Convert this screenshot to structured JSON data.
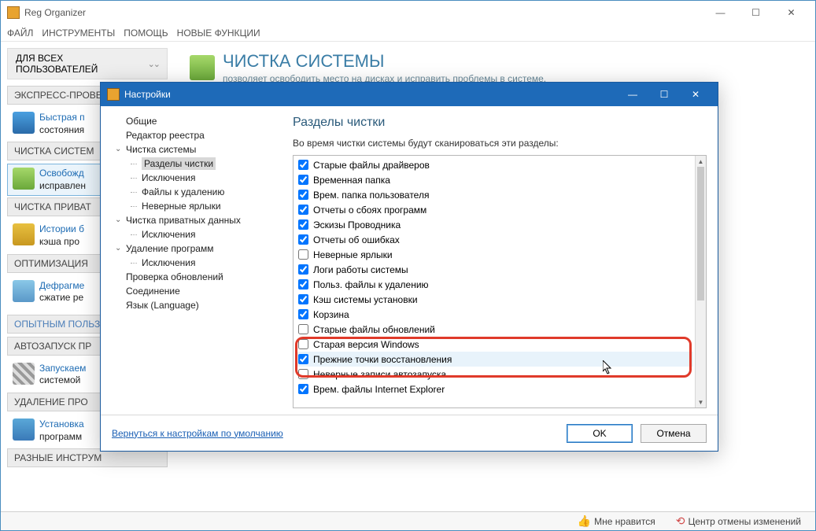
{
  "app": {
    "title": "Reg Organizer"
  },
  "menu": [
    "ФАЙЛ",
    "ИНСТРУМЕНТЫ",
    "ПОМОЩЬ",
    "НОВЫЕ ФУНКЦИИ"
  ],
  "userSwitch": "ДЛЯ ВСЕХ ПОЛЬЗОВАТЕЛЕЙ",
  "sidebar": {
    "groups": [
      {
        "header": "ЭКСПРЕСС-ПРОВЕРКА",
        "items": [
          {
            "l1": "Быстрая п",
            "l2": "состояния"
          }
        ]
      },
      {
        "header": "ЧИСТКА СИСТЕМ",
        "selected": true,
        "items": [
          {
            "l1": "Освобожд",
            "l2": "исправлен",
            "sel": true
          }
        ]
      },
      {
        "header": "ЧИСТКА ПРИВАТ",
        "items": [
          {
            "l1": "Истории б",
            "l2": "кэша про"
          }
        ]
      },
      {
        "header": "ОПТИМИЗАЦИЯ",
        "items": [
          {
            "l1": "Дефрагме",
            "l2": "сжатие ре"
          }
        ]
      }
    ],
    "header2": "ОПЫТНЫМ ПОЛЬЗ",
    "groups2": [
      {
        "header": "АВТОЗАПУСК ПР",
        "items": [
          {
            "l1": "Запускаем",
            "l2": "системой"
          }
        ]
      },
      {
        "header": "УДАЛЕНИЕ ПРО",
        "items": [
          {
            "l1": "Установка",
            "l2": "программ"
          }
        ]
      },
      {
        "header": "РАЗНЫЕ ИНСТРУМ",
        "items": []
      }
    ]
  },
  "page": {
    "title": "ЧИСТКА СИСТЕМЫ",
    "subtitle": "позволяет освободить место на дисках и исправить проблемы в системе."
  },
  "dialog": {
    "title": "Настройки",
    "tree": [
      {
        "label": "Общие",
        "lvl": 0
      },
      {
        "label": "Редактор реестра",
        "lvl": 0
      },
      {
        "label": "Чистка системы",
        "lvl": 0,
        "caret": "open"
      },
      {
        "label": "Разделы чистки",
        "lvl": 1,
        "sel": true
      },
      {
        "label": "Исключения",
        "lvl": 1
      },
      {
        "label": "Файлы к удалению",
        "lvl": 1
      },
      {
        "label": "Неверные ярлыки",
        "lvl": 1
      },
      {
        "label": "Чистка приватных данных",
        "lvl": 0,
        "caret": "open"
      },
      {
        "label": "Исключения",
        "lvl": 1
      },
      {
        "label": "Удаление программ",
        "lvl": 0,
        "caret": "open"
      },
      {
        "label": "Исключения",
        "lvl": 1
      },
      {
        "label": "Проверка обновлений",
        "lvl": 0
      },
      {
        "label": "Соединение",
        "lvl": 0
      },
      {
        "label": "Язык (Language)",
        "lvl": 0
      }
    ],
    "rightTitle": "Разделы чистки",
    "rightDesc": "Во время чистки системы будут сканироваться эти разделы:",
    "checks": [
      {
        "label": "Старые файлы драйверов",
        "checked": true
      },
      {
        "label": "Временная папка",
        "checked": true
      },
      {
        "label": "Врем. папка пользователя",
        "checked": true
      },
      {
        "label": "Отчеты о сбоях программ",
        "checked": true
      },
      {
        "label": "Эскизы Проводника",
        "checked": true
      },
      {
        "label": "Отчеты об ошибках",
        "checked": true
      },
      {
        "label": "Неверные ярлыки",
        "checked": false
      },
      {
        "label": "Логи работы системы",
        "checked": true
      },
      {
        "label": "Польз. файлы к удалению",
        "checked": true
      },
      {
        "label": "Кэш системы установки",
        "checked": true
      },
      {
        "label": "Корзина",
        "checked": true
      },
      {
        "label": "Старые файлы обновлений",
        "checked": false
      },
      {
        "label": "Старая версия Windows",
        "checked": false
      },
      {
        "label": "Прежние точки восстановления",
        "checked": true,
        "hl": true
      },
      {
        "label": "Неверные записи автозапуска",
        "checked": false
      },
      {
        "label": "Врем. файлы Internet Explorer",
        "checked": true
      }
    ],
    "resetLink": "Вернуться к настройкам по умолчанию",
    "ok": "OK",
    "cancel": "Отмена"
  },
  "status": {
    "like": "Мне нравится",
    "undo": "Центр отмены изменений"
  }
}
